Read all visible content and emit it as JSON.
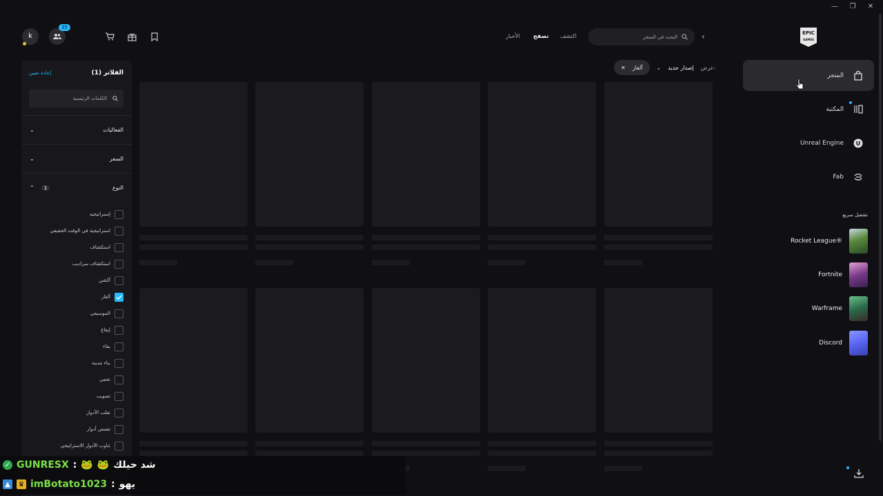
{
  "window": {
    "controls": [
      "minimize",
      "restore",
      "close"
    ]
  },
  "header": {
    "avatar_letter": "k",
    "friends_count": "35",
    "nav": [
      {
        "label": "الأخبار",
        "active": false
      },
      {
        "label": "تصفح",
        "active": true
      },
      {
        "label": "اكتشف",
        "active": false
      }
    ],
    "search_placeholder": "البحث في المتجر"
  },
  "sidebar": {
    "logo_text_1": "EPIC",
    "logo_text_2": "GAMES",
    "items": [
      {
        "label": "المتجر",
        "icon": "shopping-bag-icon",
        "active": true
      },
      {
        "label": "المكتبة",
        "icon": "library-icon",
        "active": false
      },
      {
        "label": "Unreal Engine",
        "icon": "unreal-icon",
        "active": false
      },
      {
        "label": "Fab",
        "icon": "fab-icon",
        "active": false
      }
    ],
    "quick_launch_title": "تشغيل سريع",
    "quick_launch": [
      {
        "label": "Rocket League®",
        "color": "#3a6a2a"
      },
      {
        "label": "Fortnite",
        "color": "#6a3a8a"
      },
      {
        "label": "Warframe",
        "color": "#2a5a3a"
      },
      {
        "label": "Discord",
        "color": "#5865f2"
      }
    ]
  },
  "filter_bar": {
    "show_label": "عرض:",
    "sort_value": "إصدار جديد",
    "active_chip": "ألغاز"
  },
  "filters": {
    "title": "الفلاتر (1)",
    "reset": "إعادة تعيين",
    "keywords_placeholder": "الكلمات الرئيسية",
    "sections": [
      {
        "label": "الفعاليات"
      },
      {
        "label": "السعر"
      },
      {
        "label": "النوع",
        "count": "1"
      }
    ],
    "genres": [
      {
        "label": "إستراتيجية",
        "checked": false
      },
      {
        "label": "استراتيجية في الوقت الحقيقي",
        "checked": false
      },
      {
        "label": "استكشاف",
        "checked": false
      },
      {
        "label": "استكشاف سراديب",
        "checked": false
      },
      {
        "label": "أكشن",
        "checked": false
      },
      {
        "label": "ألغاز",
        "checked": true
      },
      {
        "label": "الموسيقى",
        "checked": false
      },
      {
        "label": "إيقاع",
        "checked": false
      },
      {
        "label": "بقاء",
        "checked": false
      },
      {
        "label": "بناء مدينة",
        "checked": false
      },
      {
        "label": "تخفي",
        "checked": false
      },
      {
        "label": "تصويب",
        "checked": false
      },
      {
        "label": "تقلب الأدوار",
        "checked": false
      },
      {
        "label": "تقمص أدوار",
        "checked": false
      },
      {
        "label": "تناوب الأدوار الاستراتيجي",
        "checked": false
      }
    ]
  },
  "chat": [
    {
      "user": "GUNRESX",
      "message": "شد حيلك",
      "user_color": "#7be04a"
    },
    {
      "user": "imBotato1023",
      "message": "يهو",
      "user_color": "#7be04a"
    }
  ]
}
